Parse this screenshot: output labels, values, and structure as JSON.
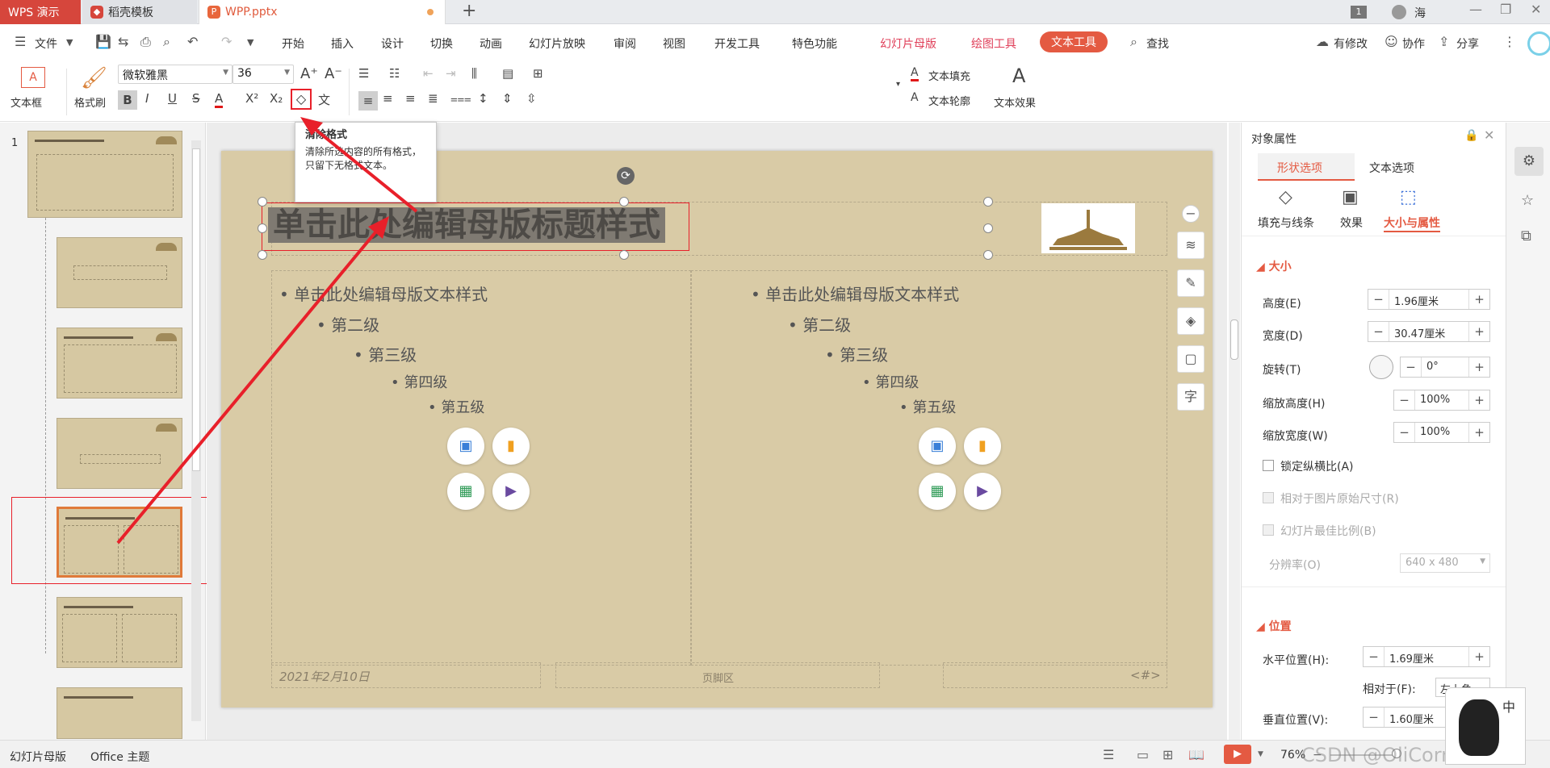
{
  "tabs": {
    "app": "WPS 演示",
    "template": "稻壳模板",
    "file": "WPP.pptx",
    "user": "海",
    "badge": "1"
  },
  "menubar": {
    "file": "文件",
    "items": [
      "开始",
      "插入",
      "设计",
      "切换",
      "动画",
      "幻灯片放映",
      "审阅",
      "视图",
      "开发工具",
      "特色功能"
    ],
    "context": [
      "幻灯片母版",
      "绘图工具"
    ],
    "active": "文本工具",
    "search": "查找",
    "right": [
      "有修改",
      "协作",
      "分享"
    ]
  },
  "ribbon": {
    "textbox": "文本框",
    "format_painter": "格式刷",
    "font_name": "微软雅黑",
    "font_size": "36",
    "text_fill": "文本填充",
    "text_outline": "文本轮廓",
    "text_effect": "文本效果",
    "styles": [
      "A",
      "A",
      "A",
      "A",
      "A",
      "A"
    ]
  },
  "tooltip": {
    "title": "清除格式",
    "body": "清除所选内容的所有格式，只留下无格式文本。"
  },
  "thumbs": {
    "slide_number": "1"
  },
  "slide": {
    "title": "单击此处编辑母版标题样式",
    "left": [
      "单击此处编辑母版文本样式",
      "第二级",
      "第三级",
      "第四级",
      "第五级"
    ],
    "right": [
      "单击此处编辑母版文本样式",
      "第二级",
      "第三级",
      "第四级",
      "第五级"
    ],
    "date": "2021年2月10日",
    "footer": "页脚区",
    "page": "<#>"
  },
  "props": {
    "title": "对象属性",
    "tabs": [
      "形状选项",
      "文本选项"
    ],
    "subtabs": [
      "填充与线条",
      "效果",
      "大小与属性"
    ],
    "size_section": "大小",
    "height_label": "高度(E)",
    "height": "1.96厘米",
    "width_label": "宽度(D)",
    "width": "30.47厘米",
    "rotate_label": "旋转(T)",
    "rotate": "0°",
    "scale_h_label": "缩放高度(H)",
    "scale_h": "100%",
    "scale_w_label": "缩放宽度(W)",
    "scale_w": "100%",
    "lock_ratio": "锁定纵横比(A)",
    "relative_original": "相对于图片原始尺寸(R)",
    "best_ratio": "幻灯片最佳比例(B)",
    "resolution_label": "分辨率(O)",
    "resolution": "640 x 480",
    "position_section": "位置",
    "hpos_label": "水平位置(H):",
    "hpos": "1.69厘米",
    "relative_label": "相对于(F):",
    "relative_value": "左上角",
    "vpos_label": "垂直位置(V):",
    "vpos": "1.60厘米"
  },
  "status": {
    "left1": "幻灯片母版",
    "left2": "Office 主题",
    "zoom": "76%",
    "watermark": "CSDN @OliCorrect",
    "ime": "中"
  },
  "colors": {
    "accent": "#e45a42",
    "wps_red": "#d6463c",
    "slide_bg": "#d9cba6",
    "annot": "#e8202a"
  }
}
